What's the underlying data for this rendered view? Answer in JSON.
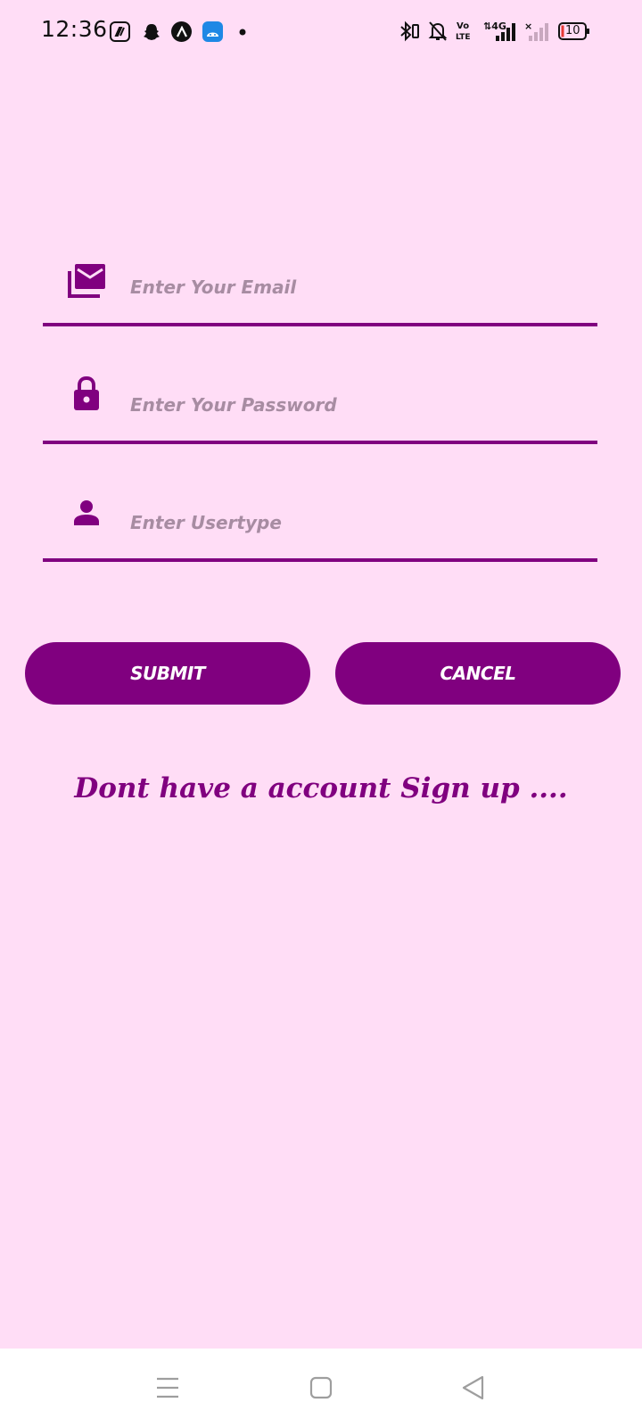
{
  "status_bar": {
    "time": "12:36",
    "battery_level": "10",
    "notification_icons": [
      "jiosaavn-icon",
      "snapchat-icon",
      "app-a-icon",
      "android-studio-icon",
      "more-dot-icon"
    ],
    "system_icons": [
      "bluetooth-icon",
      "mute-bell-icon",
      "volte-icon",
      "signal-4g-icon",
      "signal-nosim-icon",
      "battery-icon"
    ]
  },
  "form": {
    "email": {
      "placeholder": "Enter Your Email",
      "value": "",
      "icon": "email-icon"
    },
    "password": {
      "placeholder": "Enter Your Password",
      "value": "",
      "icon": "lock-icon"
    },
    "usertype": {
      "placeholder": "Enter Usertype",
      "value": "",
      "icon": "person-icon"
    }
  },
  "buttons": {
    "submit_label": "SUBMIT",
    "cancel_label": "CANCEL"
  },
  "signup_text": "Dont have a account Sign up ....",
  "nav_bar": {
    "items": [
      "menu-icon",
      "home-icon",
      "back-icon"
    ]
  },
  "colors": {
    "background": "#FFDDF6",
    "accent": "#80007F",
    "placeholder": "#A78CA2"
  }
}
